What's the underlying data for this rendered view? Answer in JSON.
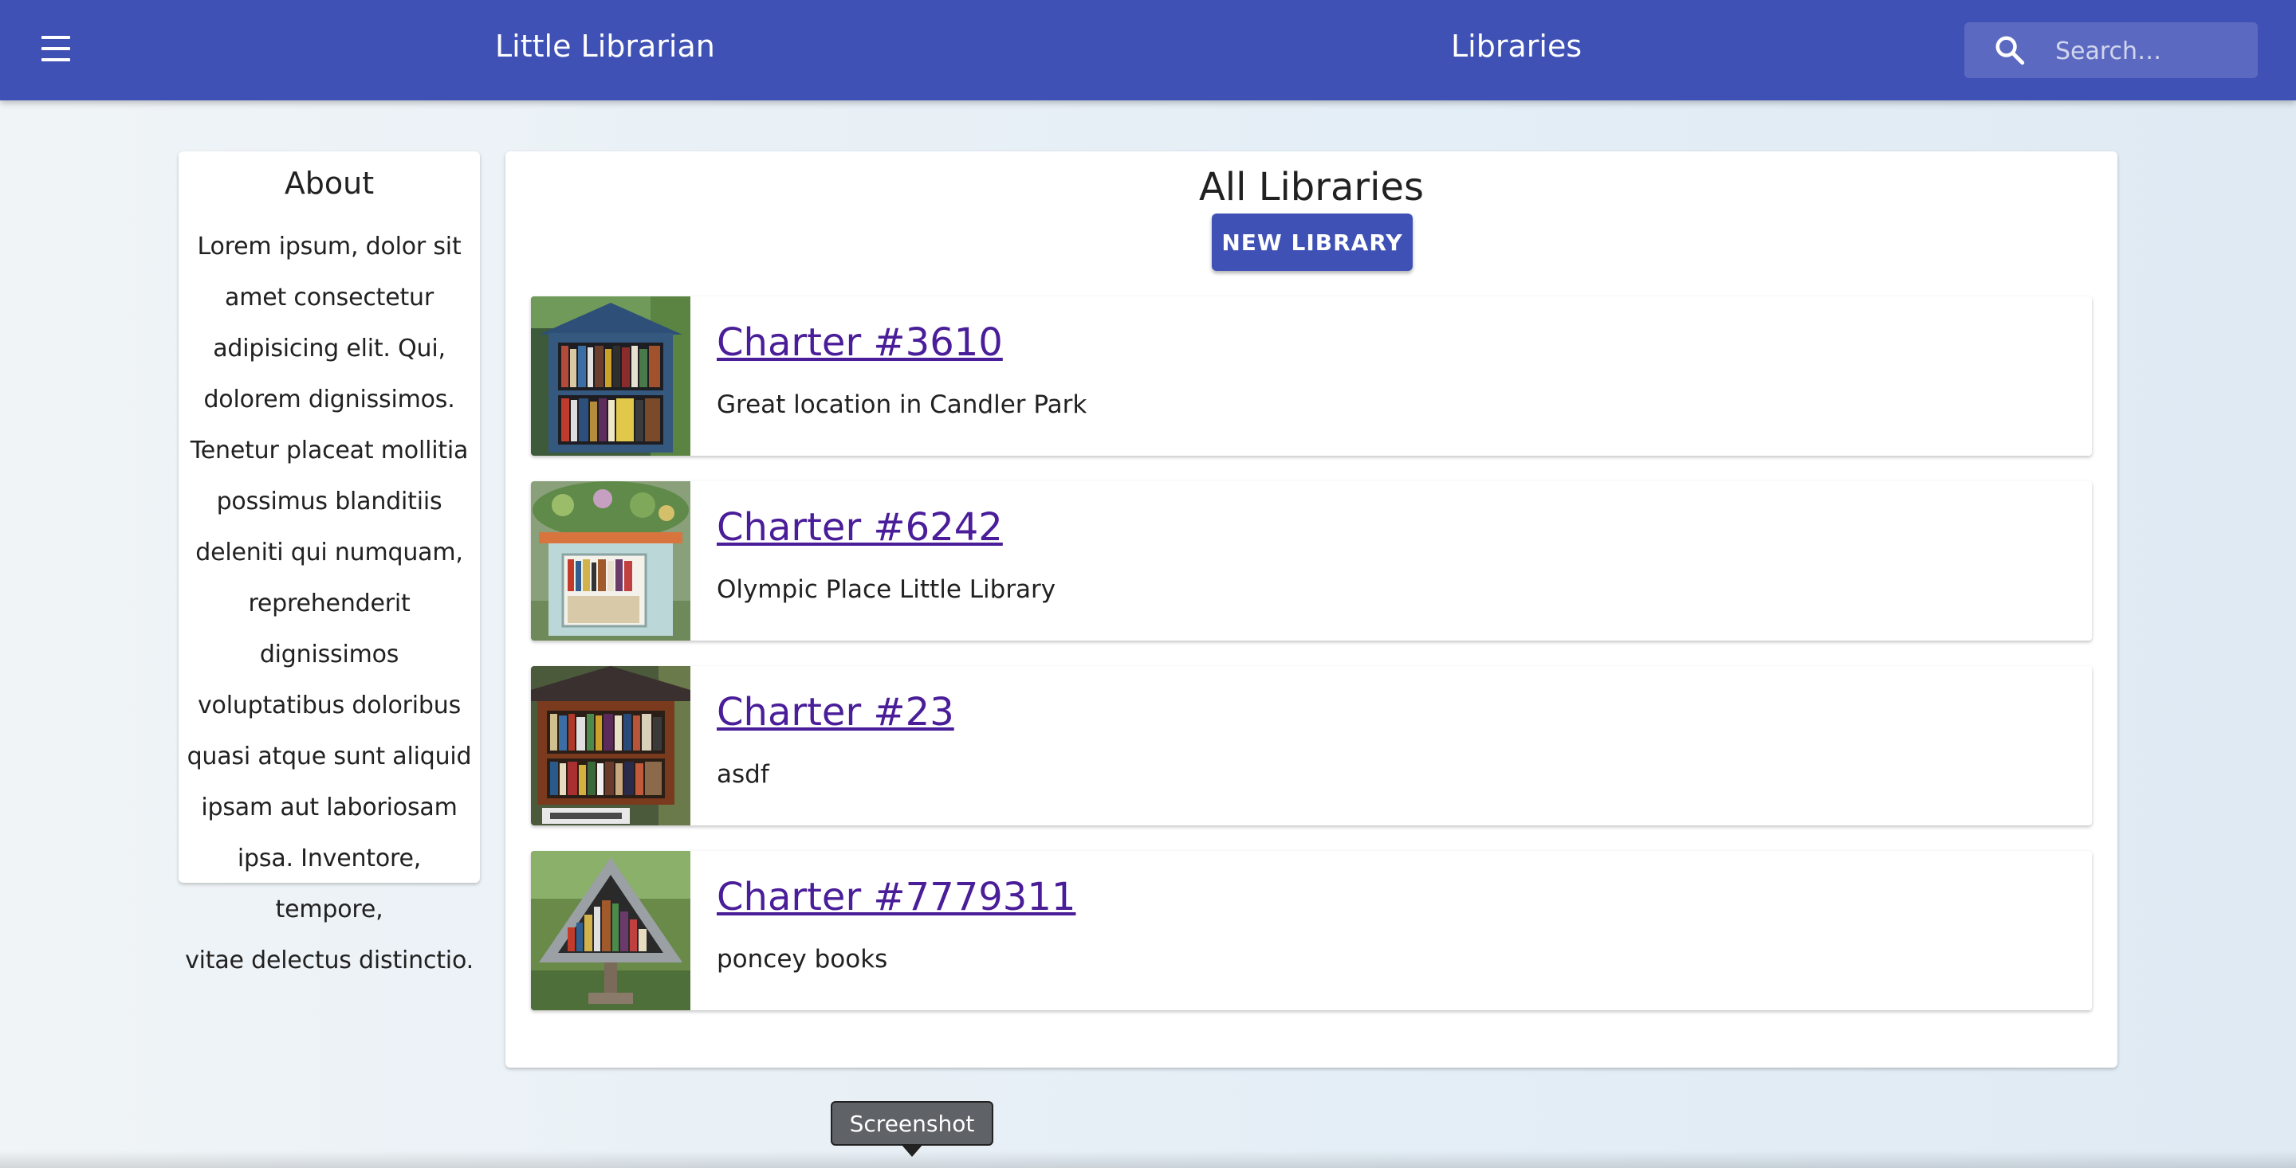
{
  "appbar": {
    "menu_icon": "hamburger-menu-icon",
    "app_title": "Little Librarian",
    "page_heading": "Libraries",
    "search": {
      "icon": "search-icon",
      "placeholder": "Search…",
      "value": ""
    },
    "color": "#3f51b5"
  },
  "about": {
    "title": "About",
    "lines": [
      "Lorem ipsum, dolor sit",
      "amet consectetur",
      "adipisicing elit. Qui,",
      "dolorem dignissimos.",
      "Tenetur placeat mollitia",
      "possimus blanditiis",
      "deleniti qui numquam,",
      "reprehenderit dignissimos",
      "voluptatibus doloribus",
      "quasi atque sunt aliquid",
      "ipsam aut laboriosam",
      "ipsa. Inventore, tempore,",
      "vitae delectus distinctio."
    ]
  },
  "main": {
    "title": "All Libraries",
    "new_button_label": "NEW LIBRARY",
    "libraries": [
      {
        "name": "Charter #3610",
        "description": "Great location in Candler Park"
      },
      {
        "name": "Charter #6242",
        "description": "Olympic Place Little Library"
      },
      {
        "name": "Charter #23",
        "description": "asdf"
      },
      {
        "name": "Charter #7779311",
        "description": "poncey books"
      }
    ]
  },
  "tooltip": {
    "text": "Screenshot"
  },
  "colors": {
    "primary": "#3f51b5",
    "link": "#4a1d99"
  }
}
